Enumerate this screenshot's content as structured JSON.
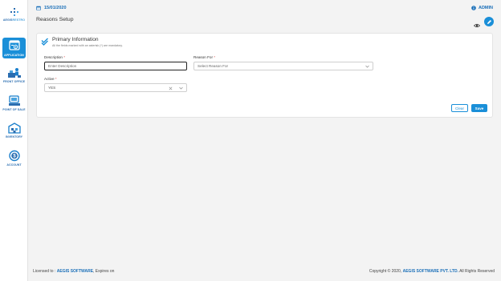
{
  "app": {
    "logo_text_a": "AEGIS",
    "logo_text_b": "RESTRO",
    "date": "15/01/2020",
    "user": "ADMIN",
    "page_title": "Reasons Setup",
    "accent_color": "#1a8fd8"
  },
  "sidebar": {
    "items": [
      {
        "label": "APPLICATION",
        "icon": "application-icon",
        "active": true
      },
      {
        "label": "FRONT OFFICE",
        "icon": "front-office-icon",
        "active": false
      },
      {
        "label": "POINT OF SALE",
        "icon": "point-of-sale-icon",
        "active": false
      },
      {
        "label": "INVENTORY",
        "icon": "inventory-icon",
        "active": false
      },
      {
        "label": "ACCOUNT",
        "icon": "account-icon",
        "active": false
      }
    ]
  },
  "form": {
    "section_title": "Primary Information",
    "section_subtitle": "All the fields marked with an asterisk (*) are mandatory.",
    "description": {
      "label": "Description",
      "required_mark": "*",
      "placeholder": "Enter Description",
      "value": ""
    },
    "reason_for": {
      "label": "Reason For",
      "required_mark": "*",
      "placeholder": "Select Reason For",
      "value": ""
    },
    "active": {
      "label": "Active",
      "required_mark": "*",
      "value": "YES"
    },
    "clear_label": "Clear",
    "save_label": "Save"
  },
  "footer": {
    "licensed_prefix": "Licensed to :",
    "licensee": "AEGIS SOFTWARE",
    "expires": ", Expires on",
    "copyright_prefix": "Copyright © 2020,",
    "company": "AEGIS SOFTWARE PVT. LTD.",
    "rights": "All Rights Reserved"
  }
}
